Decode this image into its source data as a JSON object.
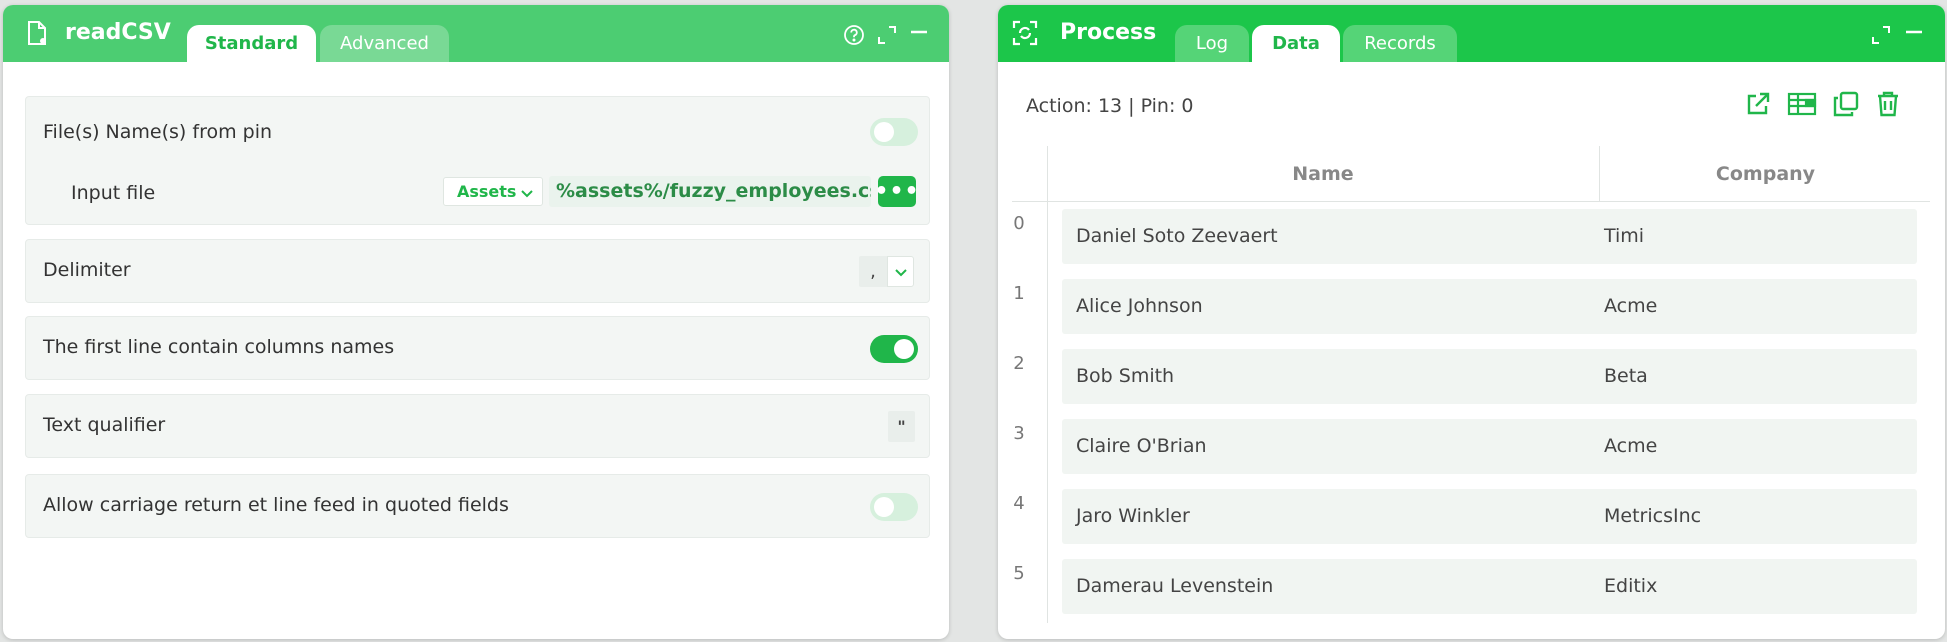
{
  "left_panel": {
    "title": "readCSV",
    "tabs": [
      {
        "label": "Standard",
        "active": true
      },
      {
        "label": "Advanced",
        "active": false
      }
    ],
    "fields": {
      "files_from_pin": {
        "label": "File(s) Name(s) from pin",
        "enabled": false
      },
      "input_file": {
        "label": "Input file",
        "source": "Assets",
        "path": "%assets%/fuzzy_employees.csv",
        "more": "•••"
      },
      "delimiter": {
        "label": "Delimiter",
        "value": ","
      },
      "header_line": {
        "label": "The first line contain columns names",
        "enabled": true
      },
      "text_qualifier": {
        "label": "Text qualifier",
        "value": "\""
      },
      "allow_crlf": {
        "label": "Allow carriage return et line feed in quoted fields",
        "enabled": false
      }
    }
  },
  "right_panel": {
    "title": "Process",
    "tabs": [
      {
        "label": "Log",
        "active": false
      },
      {
        "label": "Data",
        "active": true
      },
      {
        "label": "Records",
        "active": false
      }
    ],
    "action_info": "Action: 13 | Pin: 0",
    "table": {
      "columns": [
        "Name",
        "Company"
      ],
      "rows": [
        {
          "index": "0",
          "name": "Daniel Soto Zeevaert",
          "company": "Timi"
        },
        {
          "index": "1",
          "name": "Alice Johnson",
          "company": "Acme"
        },
        {
          "index": "2",
          "name": "Bob Smith",
          "company": "Beta"
        },
        {
          "index": "3",
          "name": "Claire O'Brian",
          "company": "Acme"
        },
        {
          "index": "4",
          "name": "Jaro Winkler",
          "company": "MetricsInc"
        },
        {
          "index": "5",
          "name": "Damerau Levenstein",
          "company": "Editix"
        }
      ]
    }
  },
  "colors": {
    "accent": "#20b64a",
    "left_header": "#4ccd72",
    "right_header": "#1cc64a"
  }
}
